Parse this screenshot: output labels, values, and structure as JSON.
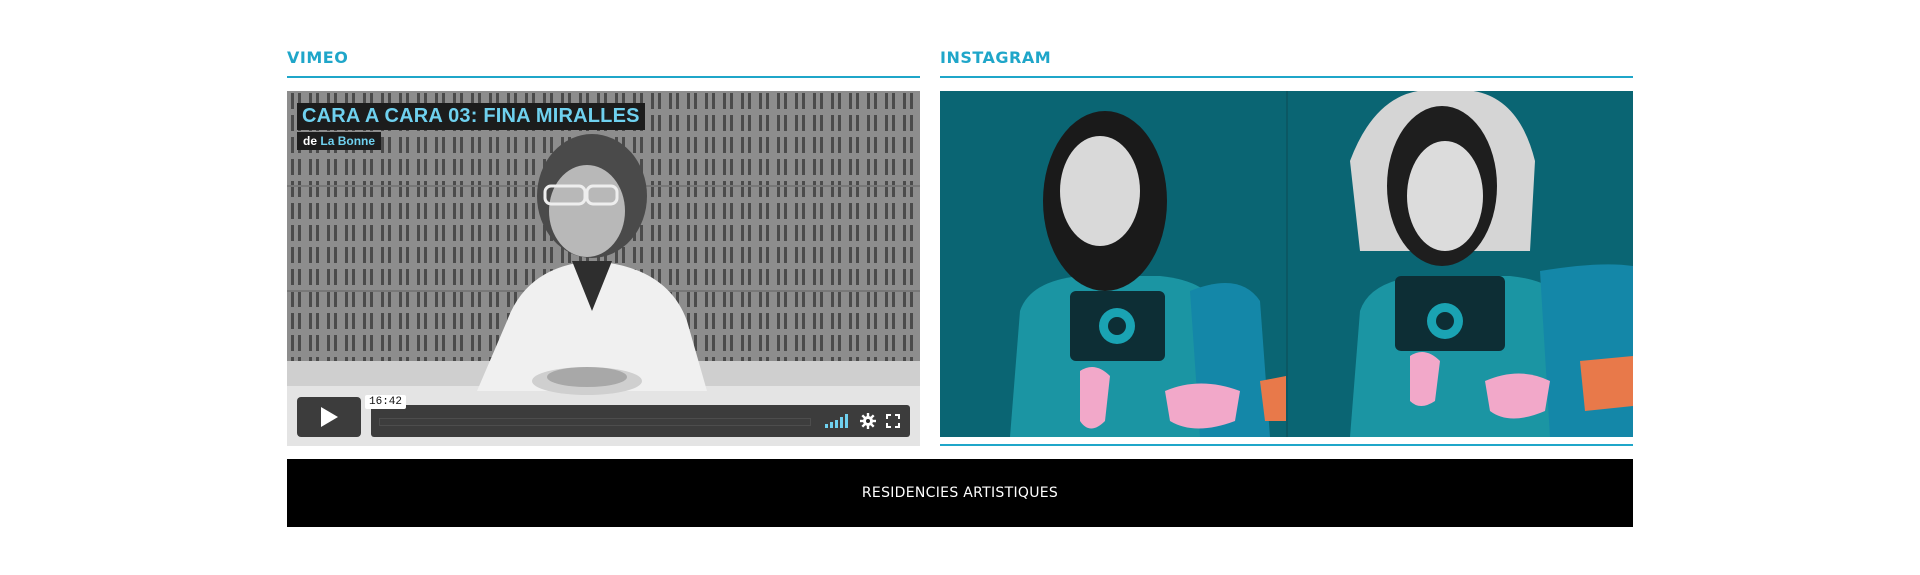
{
  "vimeo": {
    "heading": "VIMEO",
    "video": {
      "title": "CARA A CARA 03: FINA MIRALLES",
      "byline_prefix": "de",
      "author": "La Bonne",
      "duration": "16:42",
      "icons": {
        "play": "play-icon",
        "volume": "volume-icon",
        "settings": "gear-icon",
        "fullscreen": "fullscreen-icon"
      }
    }
  },
  "instagram": {
    "heading": "INSTAGRAM"
  },
  "footer": {
    "label": "RESIDENCIES ARTISTIQUES"
  },
  "colors": {
    "accent": "#1fa6c9",
    "vimeo_blue": "#6fd1ef",
    "insta_teal": "#0d6b79",
    "footer_bg": "#000000"
  }
}
